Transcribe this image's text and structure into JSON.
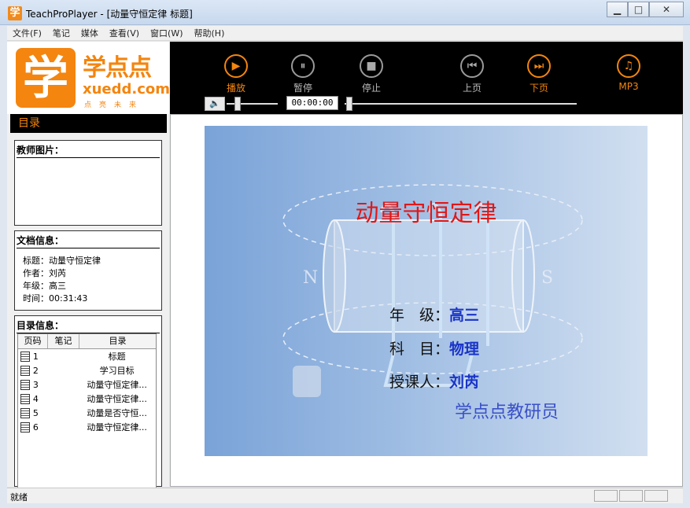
{
  "window": {
    "title": "TeachProPlayer - [动量守恒定律 标题]",
    "min_glyph": "▁",
    "max_glyph": "□",
    "close_glyph": "✕"
  },
  "menu": [
    "文件(F)",
    "笔记",
    "媒体",
    "查看(V)",
    "窗口(W)",
    "帮助(H)"
  ],
  "logo": {
    "mark": "学",
    "cn": "学点点",
    "en": "xuedd.com",
    "sub": "点亮未来"
  },
  "toc": {
    "header": "目录"
  },
  "teacher": {
    "title": "教师图片："
  },
  "doc_info": {
    "title": "文档信息：",
    "lines": [
      "标题：动量守恒定律",
      "作者：刘芮",
      "年级：高三",
      "时间：00:31:43"
    ]
  },
  "catalog": {
    "title": "目录信息：",
    "columns": [
      "页码",
      "笔记",
      "目录"
    ],
    "rows": [
      {
        "page": "1",
        "title": "标题"
      },
      {
        "page": "2",
        "title": "学习目标"
      },
      {
        "page": "3",
        "title": "动量守恒定律..."
      },
      {
        "page": "4",
        "title": "动量守恒定律..."
      },
      {
        "page": "5",
        "title": "动量是否守恒..."
      },
      {
        "page": "6",
        "title": "动量守恒定律..."
      }
    ]
  },
  "toolbar": {
    "buttons": [
      {
        "label": "播放",
        "glyph": "▶",
        "active": true
      },
      {
        "label": "暂停",
        "glyph": "⏸",
        "active": false
      },
      {
        "label": "停止",
        "glyph": "■",
        "active": false
      },
      {
        "label": "上页",
        "glyph": "⏮",
        "active": false
      },
      {
        "label": "下页",
        "glyph": "⏭",
        "active": true
      },
      {
        "label": "MP3",
        "glyph": "♫",
        "active": true
      }
    ],
    "time": "00:00:00",
    "volume_glyph": "🔈"
  },
  "slide": {
    "title": "动量守恒定律",
    "rows": [
      {
        "label": "年　级：",
        "value": "高三"
      },
      {
        "label": "科　目：",
        "value": "物理"
      },
      {
        "label": "授课人：",
        "value": "刘芮"
      }
    ],
    "footer": "学点点教研员",
    "n_label": "N",
    "s_label": "S"
  },
  "status": {
    "text": "就绪"
  },
  "colors": {
    "accent": "#f4850f",
    "title_red": "#e01818",
    "value_blue": "#1a34c8"
  }
}
